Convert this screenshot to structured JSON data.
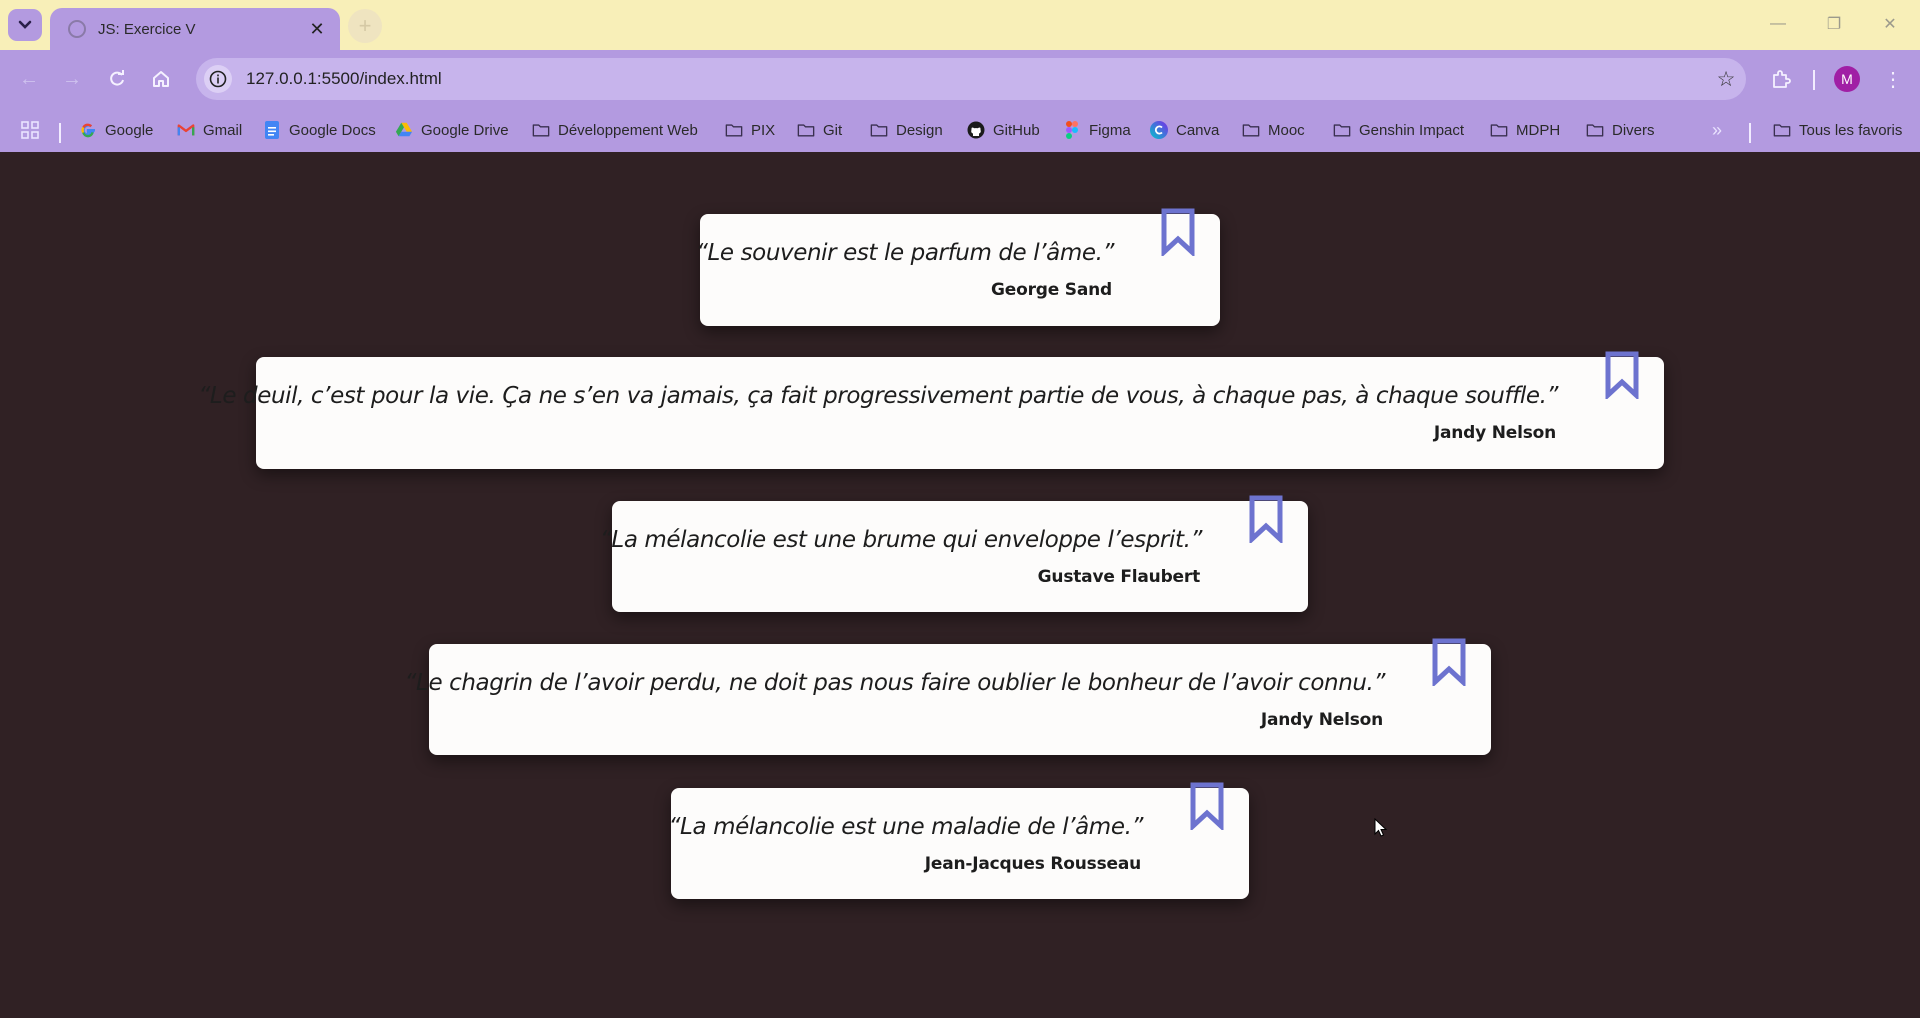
{
  "browser": {
    "tab_title": "JS: Exercice V",
    "url": "127.0.0.1:5500/index.html",
    "profile_initial": "M",
    "accent_color": "#b39ae0",
    "titlebar_color": "#f8efb8"
  },
  "bookmarks": [
    {
      "label": "Google",
      "icon": "google-icon"
    },
    {
      "label": "Gmail",
      "icon": "gmail-icon"
    },
    {
      "label": "Google Docs",
      "icon": "docs-icon"
    },
    {
      "label": "Google Drive",
      "icon": "drive-icon"
    },
    {
      "label": "Développement Web",
      "icon": "folder-icon"
    },
    {
      "label": "PIX",
      "icon": "folder-icon"
    },
    {
      "label": "Git",
      "icon": "folder-icon"
    },
    {
      "label": "Design",
      "icon": "folder-icon"
    },
    {
      "label": "GitHub",
      "icon": "github-icon"
    },
    {
      "label": "Figma",
      "icon": "figma-icon"
    },
    {
      "label": "Canva",
      "icon": "canva-icon"
    },
    {
      "label": "Mooc",
      "icon": "folder-icon"
    },
    {
      "label": "Genshin Impact",
      "icon": "folder-icon"
    },
    {
      "label": "MDPH",
      "icon": "folder-icon"
    },
    {
      "label": "Divers",
      "icon": "folder-icon"
    }
  ],
  "all_bookmarks_label": "Tous les favoris",
  "quotes": [
    {
      "text": "“Le souvenir est le parfum de l’âme.”",
      "author": "George Sand"
    },
    {
      "text": "“Le deuil, c’est pour la vie. Ça ne s’en va jamais, ça fait progressivement partie de vous, à chaque pas, à chaque souffle.”",
      "author": "Jandy Nelson"
    },
    {
      "text": "“La mélancolie est une brume qui enveloppe l’esprit.”",
      "author": "Gustave Flaubert"
    },
    {
      "text": "“Le chagrin de l’avoir perdu, ne doit pas nous faire oublier le bonheur de l’avoir connu.”",
      "author": "Jandy Nelson"
    },
    {
      "text": "“La mélancolie est une maladie de l’âme.”",
      "author": "Jean-Jacques Rousseau"
    }
  ],
  "page_background": "#302124",
  "bookmark_icon_color": "#6d73cf"
}
